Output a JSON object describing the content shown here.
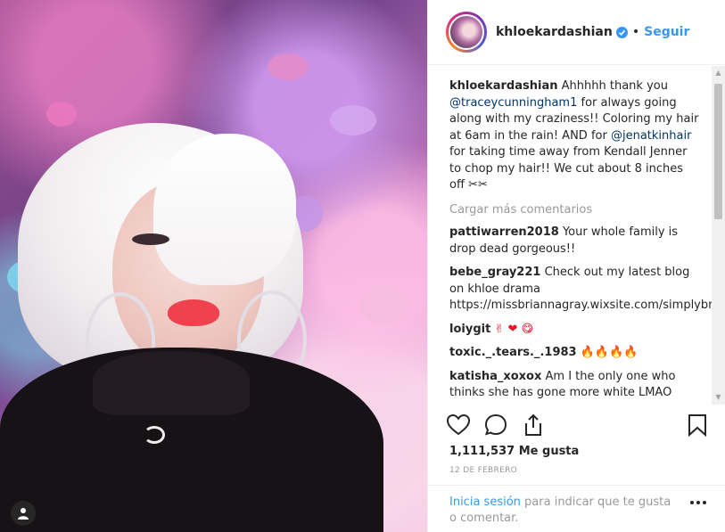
{
  "post": {
    "username": "khloekardashian",
    "follow_label": "Seguir",
    "separator": "•",
    "caption": {
      "text_1": "Ahhhhh thank you",
      "mention_1": "@traceycunningham1",
      "text_2": "for always going along with my craziness!! Coloring my hair at 6am in the rain! AND for",
      "mention_2": "@jenatkinhair",
      "text_3": "for taking time away from Kendall Jenner to chop my hair!! We cut about 8 inches off",
      "emoji": "✂✂"
    },
    "load_more_label": "Cargar más comentarios",
    "comments": [
      {
        "user": "pattiwarren2018",
        "text": "Your whole family is drop dead gorgeous!!"
      },
      {
        "user": "bebe_gray221",
        "text": "Check out my latest blog on khloe drama https://missbriannagray.wixsite.com/simplybrianna/blog"
      },
      {
        "user": "loiygit",
        "text": "✌ ❤ 😋"
      },
      {
        "user": "toxic._.tears._.1983",
        "text": "🔥🔥🔥🔥"
      },
      {
        "user": "katisha_xoxox",
        "text": "Am I the only one who thinks she has gone more white LMAO"
      }
    ],
    "likes": "1,111,537",
    "likes_label": "Me gusta",
    "date": "12 DE FEBRERO",
    "login": {
      "link": "Inicia sesión",
      "text": "para indicar que te gusta o comentar."
    }
  },
  "icons": {
    "verified": "verified-badge-icon",
    "heart": "heart-icon",
    "comment": "comment-icon",
    "share": "share-icon",
    "bookmark": "bookmark-icon",
    "more": "more-options-icon",
    "owner": "person-icon"
  },
  "colors": {
    "link_blue": "#3897f0",
    "mention": "#003569",
    "text": "#262626",
    "muted": "#999999"
  }
}
